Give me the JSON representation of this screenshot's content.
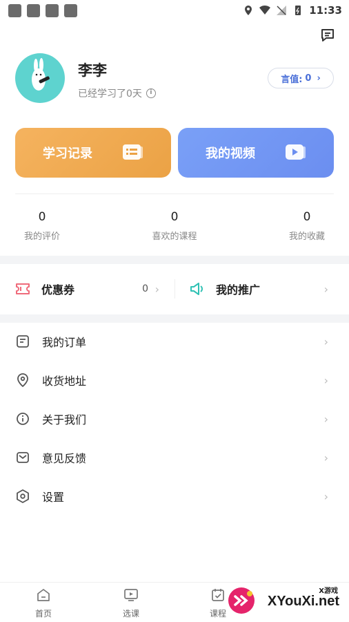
{
  "status_bar": {
    "time": "11:33"
  },
  "profile": {
    "name": "李李",
    "study_days": "已经学习了0天",
    "value_label": "言值:",
    "value": "0"
  },
  "cards": [
    {
      "label": "学习记录",
      "icon": "list-card-icon"
    },
    {
      "label": "我的视频",
      "icon": "video-card-icon"
    }
  ],
  "stats": [
    {
      "value": "0",
      "label": "我的评价"
    },
    {
      "value": "0",
      "label": "喜欢的课程"
    },
    {
      "value": "0",
      "label": "我的收藏"
    }
  ],
  "coupon": {
    "label": "优惠券",
    "count": "0"
  },
  "promotion": {
    "label": "我的推广"
  },
  "menu": [
    {
      "label": "我的订单",
      "icon": "order-icon"
    },
    {
      "label": "收货地址",
      "icon": "location-icon"
    },
    {
      "label": "关于我们",
      "icon": "info-icon"
    },
    {
      "label": "意见反馈",
      "icon": "mail-icon"
    },
    {
      "label": "设置",
      "icon": "settings-icon"
    }
  ],
  "tabs": [
    {
      "label": "首页",
      "icon": "home-icon"
    },
    {
      "label": "选课",
      "icon": "tv-icon"
    },
    {
      "label": "课程",
      "icon": "calendar-check-icon"
    }
  ],
  "watermark": {
    "text": "XYouXi.net",
    "small": "X游戏"
  },
  "colors": {
    "accent_blue": "#6b8ef0",
    "accent_orange": "#eba245",
    "avatar_teal": "#5ed3cf"
  }
}
